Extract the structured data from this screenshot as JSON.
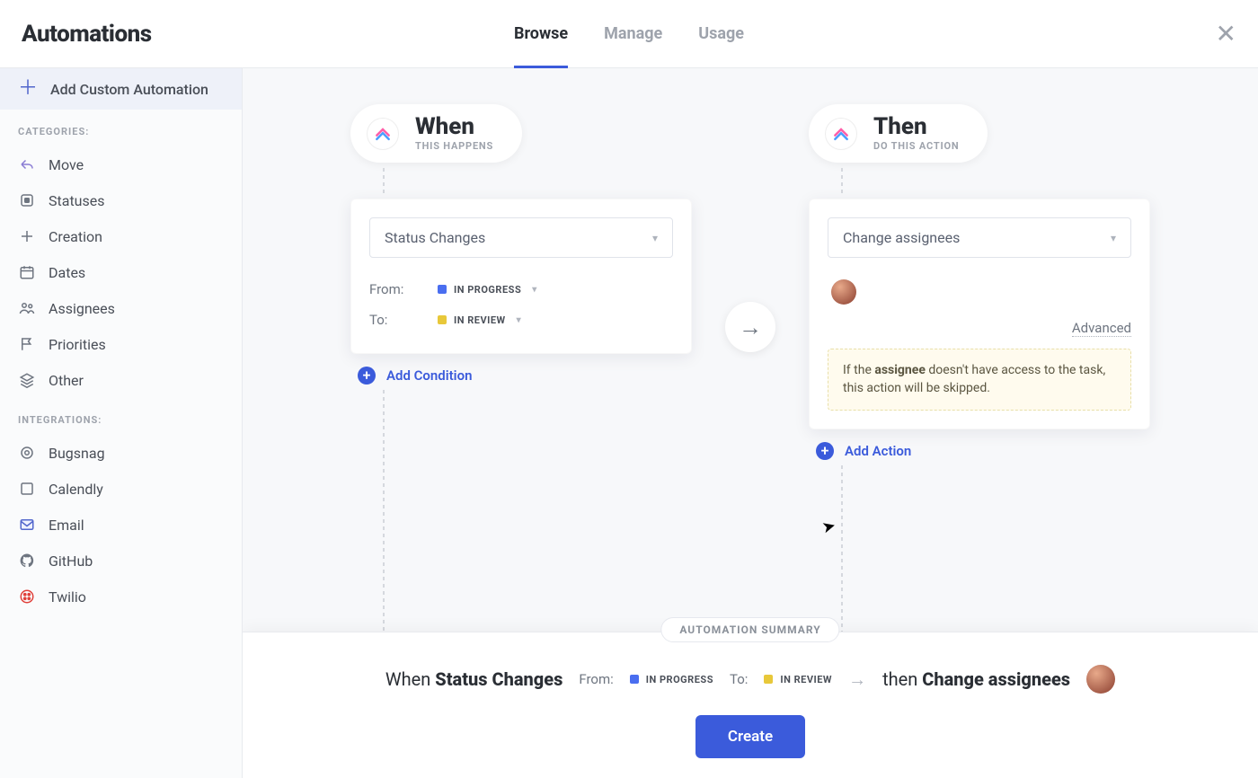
{
  "header": {
    "title": "Automations",
    "tabs": [
      {
        "label": "Browse",
        "active": true
      },
      {
        "label": "Manage",
        "active": false
      },
      {
        "label": "Usage",
        "active": false
      }
    ]
  },
  "sidebar": {
    "add_custom": "Add Custom Automation",
    "categories_label": "CATEGORIES:",
    "categories": [
      {
        "label": "Move"
      },
      {
        "label": "Statuses"
      },
      {
        "label": "Creation"
      },
      {
        "label": "Dates"
      },
      {
        "label": "Assignees"
      },
      {
        "label": "Priorities"
      },
      {
        "label": "Other"
      }
    ],
    "integrations_label": "INTEGRATIONS:",
    "integrations": [
      {
        "label": "Bugsnag"
      },
      {
        "label": "Calendly"
      },
      {
        "label": "Email"
      },
      {
        "label": "GitHub"
      },
      {
        "label": "Twilio"
      }
    ]
  },
  "when": {
    "title": "When",
    "subtitle": "THIS HAPPENS",
    "trigger": "Status Changes",
    "from_label": "From:",
    "from_status": "IN PROGRESS",
    "from_color": "#4a6ef0",
    "to_label": "To:",
    "to_status": "IN REVIEW",
    "to_color": "#e8c83a",
    "add_condition": "Add Condition"
  },
  "then": {
    "title": "Then",
    "subtitle": "DO THIS ACTION",
    "action": "Change assignees",
    "advanced": "Advanced",
    "warning_prefix": "If the ",
    "warning_bold": "assignee",
    "warning_suffix": " doesn't have access to the task, this action will be skipped.",
    "add_action": "Add Action"
  },
  "summary": {
    "badge": "AUTOMATION SUMMARY",
    "when_prefix": "When ",
    "when_strong": "Status Changes",
    "from_label": "From:",
    "from_status": "IN PROGRESS",
    "to_label": "To:",
    "to_status": "IN REVIEW",
    "then_prefix": "then ",
    "then_strong": "Change assignees",
    "create": "Create"
  },
  "colors": {
    "in_progress": "#4a6ef0",
    "in_review": "#e8c83a"
  }
}
